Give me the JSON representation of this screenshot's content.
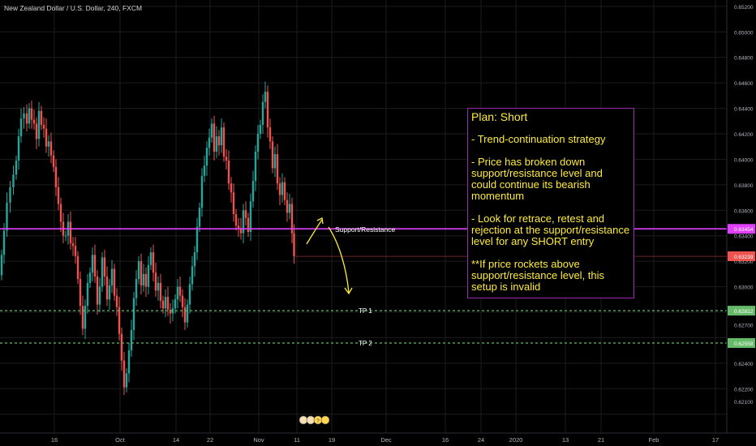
{
  "symbol_title": "New Zealand Dollar / U.S. Dollar, 240, FXCM",
  "colors": {
    "background": "#000000",
    "grid": "#1c1c1c",
    "up_candle": "#26a69a",
    "down_candle": "#ef5350",
    "support_line": "#e040fb",
    "tp_line": "#66bb6a",
    "current_price_line": "#ef5350",
    "annotation_text": "#ffeb3b",
    "axis_text": "#b2b5be"
  },
  "chart_data": {
    "type": "candlestick",
    "title": "New Zealand Dollar / U.S. Dollar, 240, FXCM",
    "ylim": [
      0.6175,
      0.6525
    ],
    "y_ticks": [
      "0.65200",
      "0.65000",
      "0.64800",
      "0.64600",
      "0.64400",
      "0.64200",
      "0.64000",
      "0.63800",
      "0.63600",
      "0.63454",
      "0.63400",
      "0.63239",
      "0.63200",
      "0.63000",
      "0.62800",
      "0.62812",
      "0.62700",
      "0.62558",
      "0.62400",
      "0.62200",
      "0.62100",
      "0.61800",
      "0.61840"
    ],
    "x_ticks": [
      "16",
      "Oct",
      "14",
      "22",
      "Nov",
      "11",
      "19",
      "Dec",
      "16",
      "24",
      "2020",
      "13",
      "21",
      "Feb",
      "17"
    ],
    "price_path": [
      {
        "x": 0,
        "y": 0.6309
      },
      {
        "x": 3,
        "y": 0.6325
      },
      {
        "x": 6,
        "y": 0.6344
      },
      {
        "x": 10,
        "y": 0.6366
      },
      {
        "x": 14,
        "y": 0.6378
      },
      {
        "x": 18,
        "y": 0.6388
      },
      {
        "x": 21,
        "y": 0.6399
      },
      {
        "x": 24,
        "y": 0.6418
      },
      {
        "x": 27,
        "y": 0.6432
      },
      {
        "x": 31,
        "y": 0.6436
      },
      {
        "x": 34,
        "y": 0.6428
      },
      {
        "x": 37,
        "y": 0.644
      },
      {
        "x": 40,
        "y": 0.6431
      },
      {
        "x": 43,
        "y": 0.6428
      },
      {
        "x": 46,
        "y": 0.6416
      },
      {
        "x": 49,
        "y": 0.6438
      },
      {
        "x": 52,
        "y": 0.6427
      },
      {
        "x": 55,
        "y": 0.6424
      },
      {
        "x": 58,
        "y": 0.641
      },
      {
        "x": 61,
        "y": 0.6414
      },
      {
        "x": 64,
        "y": 0.6403
      },
      {
        "x": 67,
        "y": 0.6394
      },
      {
        "x": 70,
        "y": 0.6378
      },
      {
        "x": 73,
        "y": 0.6365
      },
      {
        "x": 76,
        "y": 0.6351
      },
      {
        "x": 79,
        "y": 0.634
      },
      {
        "x": 82,
        "y": 0.634
      },
      {
        "x": 85,
        "y": 0.6351
      },
      {
        "x": 88,
        "y": 0.6334
      },
      {
        "x": 91,
        "y": 0.6332
      },
      {
        "x": 94,
        "y": 0.6324
      },
      {
        "x": 97,
        "y": 0.6306
      },
      {
        "x": 100,
        "y": 0.6285
      },
      {
        "x": 103,
        "y": 0.6267
      },
      {
        "x": 106,
        "y": 0.6285
      },
      {
        "x": 109,
        "y": 0.6303
      },
      {
        "x": 112,
        "y": 0.6311
      },
      {
        "x": 115,
        "y": 0.6325
      },
      {
        "x": 118,
        "y": 0.6308
      },
      {
        "x": 121,
        "y": 0.6286
      },
      {
        "x": 124,
        "y": 0.63
      },
      {
        "x": 127,
        "y": 0.6323
      },
      {
        "x": 130,
        "y": 0.6308
      },
      {
        "x": 133,
        "y": 0.629
      },
      {
        "x": 136,
        "y": 0.6301
      },
      {
        "x": 139,
        "y": 0.6314
      },
      {
        "x": 142,
        "y": 0.6293
      },
      {
        "x": 145,
        "y": 0.6284
      },
      {
        "x": 148,
        "y": 0.6263
      },
      {
        "x": 151,
        "y": 0.6242
      },
      {
        "x": 154,
        "y": 0.6221
      },
      {
        "x": 157,
        "y": 0.6232
      },
      {
        "x": 160,
        "y": 0.625
      },
      {
        "x": 163,
        "y": 0.6266
      },
      {
        "x": 166,
        "y": 0.6291
      },
      {
        "x": 169,
        "y": 0.6306
      },
      {
        "x": 172,
        "y": 0.632
      },
      {
        "x": 175,
        "y": 0.6301
      },
      {
        "x": 178,
        "y": 0.631
      },
      {
        "x": 181,
        "y": 0.63
      },
      {
        "x": 184,
        "y": 0.6317
      },
      {
        "x": 187,
        "y": 0.6327
      },
      {
        "x": 190,
        "y": 0.6311
      },
      {
        "x": 193,
        "y": 0.6297
      },
      {
        "x": 196,
        "y": 0.6303
      },
      {
        "x": 199,
        "y": 0.6289
      },
      {
        "x": 202,
        "y": 0.6283
      },
      {
        "x": 205,
        "y": 0.6292
      },
      {
        "x": 208,
        "y": 0.6282
      },
      {
        "x": 211,
        "y": 0.6279
      },
      {
        "x": 214,
        "y": 0.6283
      },
      {
        "x": 217,
        "y": 0.629
      },
      {
        "x": 220,
        "y": 0.63
      },
      {
        "x": 223,
        "y": 0.6293
      },
      {
        "x": 226,
        "y": 0.6284
      },
      {
        "x": 229,
        "y": 0.6272
      },
      {
        "x": 232,
        "y": 0.6286
      },
      {
        "x": 235,
        "y": 0.6302
      },
      {
        "x": 238,
        "y": 0.6316
      },
      {
        "x": 241,
        "y": 0.6327
      },
      {
        "x": 244,
        "y": 0.6347
      },
      {
        "x": 247,
        "y": 0.6362
      },
      {
        "x": 250,
        "y": 0.6387
      },
      {
        "x": 253,
        "y": 0.6395
      },
      {
        "x": 256,
        "y": 0.6409
      },
      {
        "x": 259,
        "y": 0.6417
      },
      {
        "x": 262,
        "y": 0.6428
      },
      {
        "x": 265,
        "y": 0.6406
      },
      {
        "x": 268,
        "y": 0.6418
      },
      {
        "x": 271,
        "y": 0.6411
      },
      {
        "x": 274,
        "y": 0.6425
      },
      {
        "x": 277,
        "y": 0.6402
      },
      {
        "x": 280,
        "y": 0.6399
      },
      {
        "x": 283,
        "y": 0.6381
      },
      {
        "x": 286,
        "y": 0.6374
      },
      {
        "x": 289,
        "y": 0.6357
      },
      {
        "x": 292,
        "y": 0.6348
      },
      {
        "x": 295,
        "y": 0.6346
      },
      {
        "x": 298,
        "y": 0.6342
      },
      {
        "x": 301,
        "y": 0.636
      },
      {
        "x": 304,
        "y": 0.6354
      },
      {
        "x": 307,
        "y": 0.6343
      },
      {
        "x": 310,
        "y": 0.6367
      },
      {
        "x": 313,
        "y": 0.6383
      },
      {
        "x": 316,
        "y": 0.6406
      },
      {
        "x": 319,
        "y": 0.642
      },
      {
        "x": 322,
        "y": 0.6427
      },
      {
        "x": 325,
        "y": 0.6445
      },
      {
        "x": 328,
        "y": 0.6453
      },
      {
        "x": 331,
        "y": 0.6425
      },
      {
        "x": 334,
        "y": 0.6414
      },
      {
        "x": 337,
        "y": 0.6393
      },
      {
        "x": 340,
        "y": 0.6404
      },
      {
        "x": 343,
        "y": 0.6381
      },
      {
        "x": 346,
        "y": 0.6372
      },
      {
        "x": 349,
        "y": 0.6382
      },
      {
        "x": 352,
        "y": 0.6368
      },
      {
        "x": 355,
        "y": 0.6358
      },
      {
        "x": 358,
        "y": 0.6365
      },
      {
        "x": 361,
        "y": 0.6342
      },
      {
        "x": 363,
        "y": 0.6324
      }
    ],
    "horizontal_lines": [
      {
        "label": "Support/Resistance",
        "price": 0.63454
      },
      {
        "label": "TP 1",
        "price": 0.62812
      },
      {
        "label": "TP 2",
        "price": 0.62558
      },
      {
        "label": "",
        "price": 0.63239
      }
    ],
    "price_tags": [
      "0.63454",
      "0.63239",
      "0.62812",
      "0.62558"
    ]
  },
  "plan": {
    "title": "Plan: Short",
    "line1": "- Trend-continuation strategy",
    "line2": "- Price has broken down support/resistance level and could continue its bearish momentum",
    "line3": "- Look for retrace, retest and rejection at the support/resistance level for any SHORT entry",
    "line4": "**If price rockets above support/resistance level, this setup is invalid"
  },
  "event_badges": [
    "?",
    "?",
    "?"
  ]
}
